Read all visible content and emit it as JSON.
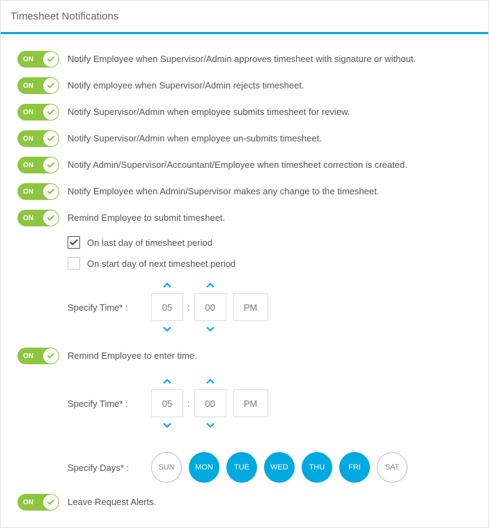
{
  "header": {
    "title": "Timesheet Notifications"
  },
  "toggle_on_label": "ON",
  "rows": [
    {
      "text": "Notify Employee when Supervisor/Admin approves timesheet with signature or without."
    },
    {
      "text": "Notify employee when Supervisor/Admin rejects timesheet."
    },
    {
      "text": "Notify Supervisor/Admin when employee submits timesheet for review."
    },
    {
      "text": "Notify Supervisor/Admin when employee un-submits timesheet."
    },
    {
      "text": "Notify Admin/Supervisor/Accountant/Employee when timesheet correction is created."
    },
    {
      "text": "Notify Employee when Admin/Supervisor makes any change to the timesheet."
    }
  ],
  "remind_submit": {
    "text": "Remind Employee to submit timesheet.",
    "checkbox1": "On last day of timesheet period",
    "checkbox2": "On start day of next timesheet period",
    "time_label": "Specify Time* :",
    "hour": "05",
    "minute": "00",
    "ampm": "PM"
  },
  "remind_enter": {
    "text": "Remind Employee to enter time.",
    "time_label": "Specify Time* :",
    "hour": "05",
    "minute": "00",
    "ampm": "PM",
    "days_label": "Specify Days* :",
    "days": [
      {
        "label": "SUN",
        "selected": false
      },
      {
        "label": "MON",
        "selected": true
      },
      {
        "label": "TUE",
        "selected": true
      },
      {
        "label": "WED",
        "selected": true
      },
      {
        "label": "THU",
        "selected": true
      },
      {
        "label": "FRI",
        "selected": true
      },
      {
        "label": "SAT",
        "selected": false
      }
    ]
  },
  "leave_alerts": {
    "text": "Leave Request Alerts."
  }
}
